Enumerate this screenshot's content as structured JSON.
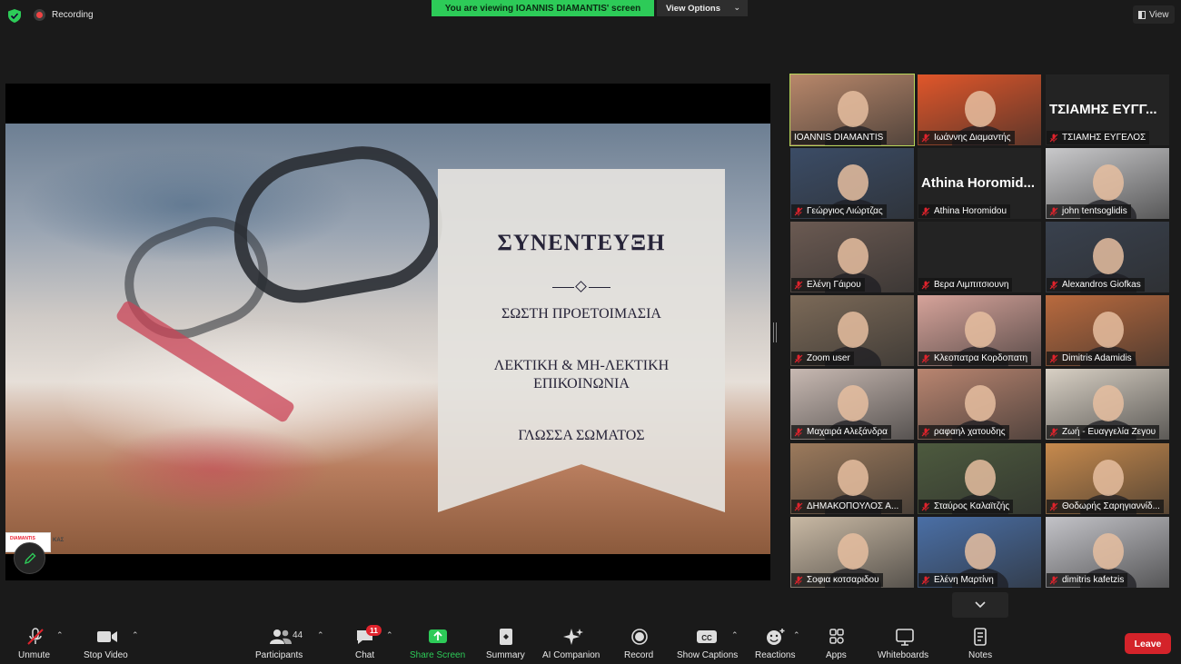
{
  "topbar": {
    "recording": "Recording",
    "viewing_banner": "You are viewing IOANNIS DIAMANTIS' screen",
    "view_options": "View Options",
    "view": "View"
  },
  "slide": {
    "title": "ΣΥΝΕΝΤΕΥΞΗ",
    "line1": "ΣΩΣΤΗ ΠΡΟΕΤΟΙΜΑΣΙΑ",
    "line2": "ΛΕΚΤΙΚΗ & ΜΗ-ΛΕΚΤΙΚΗ",
    "line3": "ΕΠΙΚΟΙΝΩΝΙΑ",
    "line4": "ΓΛΩΣΣΑ ΣΩΜΑΤΟΣ",
    "logo_text": "DIAMANTIS",
    "logo2_text": "ΚΑΣ"
  },
  "participants": [
    {
      "name": "IOANNIS DIAMANTIS",
      "muted": false,
      "active": true,
      "video": true,
      "bg": "#b8876a"
    },
    {
      "name": "Ιωάννης Διαμαντής",
      "muted": true,
      "video": true,
      "bg": "#e0562a"
    },
    {
      "name": "ΤΣΙΑΜΗΣ ΕΥΓΕΛΟΣ",
      "display": "ΤΣΙΑΜΗΣ ΕΥΓΓ...",
      "muted": true,
      "video": false
    },
    {
      "name": "Γεώργιος Λιώρτζας",
      "muted": true,
      "video": true,
      "bg": "#3b4c66"
    },
    {
      "name": "Athina Horomidou",
      "display": "Athina Horomid...",
      "muted": true,
      "video": false
    },
    {
      "name": "john tentsoglidis",
      "muted": true,
      "video": true,
      "bg": "#c9c9cb"
    },
    {
      "name": "Ελένη Γάιρου",
      "muted": true,
      "video": true,
      "bg": "#6b5a52"
    },
    {
      "name": "Βερα Λιμπιτσιουνη",
      "muted": true,
      "video": false
    },
    {
      "name": "Alexandros Giofkas",
      "muted": true,
      "video": true,
      "bg": "#39414e"
    },
    {
      "name": "Zoom user",
      "muted": true,
      "video": true,
      "bg": "#7c6a58"
    },
    {
      "name": "Κλεοπατρα Κορδοπατη",
      "muted": true,
      "video": true,
      "bg": "#d6a39a"
    },
    {
      "name": "Dimitris Adamidis",
      "muted": true,
      "video": true,
      "bg": "#b96a3e"
    },
    {
      "name": "Μαχαιρά Αλεξάνδρα",
      "muted": true,
      "video": true,
      "bg": "#c8b9b2"
    },
    {
      "name": "ραφαηλ χατουδης",
      "muted": true,
      "video": true,
      "bg": "#b98570"
    },
    {
      "name": "Ζωή - Ευαγγελία Ζεγου",
      "muted": true,
      "video": true,
      "bg": "#d8d0c4"
    },
    {
      "name": "ΔΗΜΑΚΟΠΟΥΛΟΣ Α...",
      "muted": true,
      "video": true,
      "bg": "#9c7a5c"
    },
    {
      "name": "Σταύρος Καλαϊτζής",
      "muted": true,
      "video": true,
      "bg": "#4d5a3e"
    },
    {
      "name": "Θοδωρής Σαρηγιαννίδ...",
      "muted": true,
      "video": true,
      "bg": "#c78a4d"
    },
    {
      "name": "Σοφια κοτσαριδου",
      "muted": true,
      "video": true,
      "bg": "#c9b9a4"
    },
    {
      "name": "Ελένη Μαρτίνη",
      "muted": true,
      "video": true,
      "bg": "#4a6fa6"
    },
    {
      "name": "dimitris kafetzis",
      "muted": true,
      "video": true,
      "bg": "#c3c3c8"
    }
  ],
  "toolbar": {
    "unmute": "Unmute",
    "stop_video": "Stop Video",
    "participants": "Participants",
    "participants_count": "44",
    "chat": "Chat",
    "chat_badge": "11",
    "share_screen": "Share Screen",
    "summary": "Summary",
    "ai_companion": "AI Companion",
    "record": "Record",
    "show_captions": "Show Captions",
    "reactions": "Reactions",
    "apps": "Apps",
    "whiteboards": "Whiteboards",
    "notes": "Notes",
    "leave": "Leave"
  },
  "colors": {
    "share_green": "#2dcb58",
    "leave_red": "#d4232a",
    "active_border": "#b8d65a"
  }
}
